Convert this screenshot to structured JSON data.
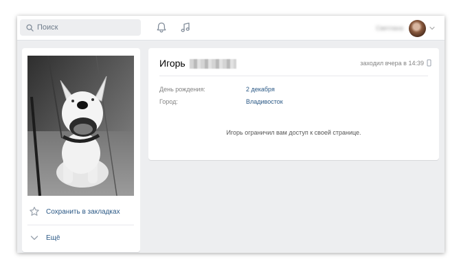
{
  "header": {
    "search_placeholder": "Поиск",
    "user_name": "Светлана"
  },
  "sidebar": {
    "bookmark_label": "Сохранить в закладках",
    "more_label": "Ещё"
  },
  "profile": {
    "first_name": "Игорь",
    "last_seen": "заходил вчера в 14:39",
    "fields": [
      {
        "label": "День рождения:",
        "value": "2 декабря"
      },
      {
        "label": "Город:",
        "value": "Владивосток"
      }
    ],
    "restricted_message": "Игорь ограничил вам доступ к своей странице."
  },
  "colors": {
    "link": "#2a5885",
    "page_background": "#edeef0",
    "muted_text": "#828282"
  }
}
